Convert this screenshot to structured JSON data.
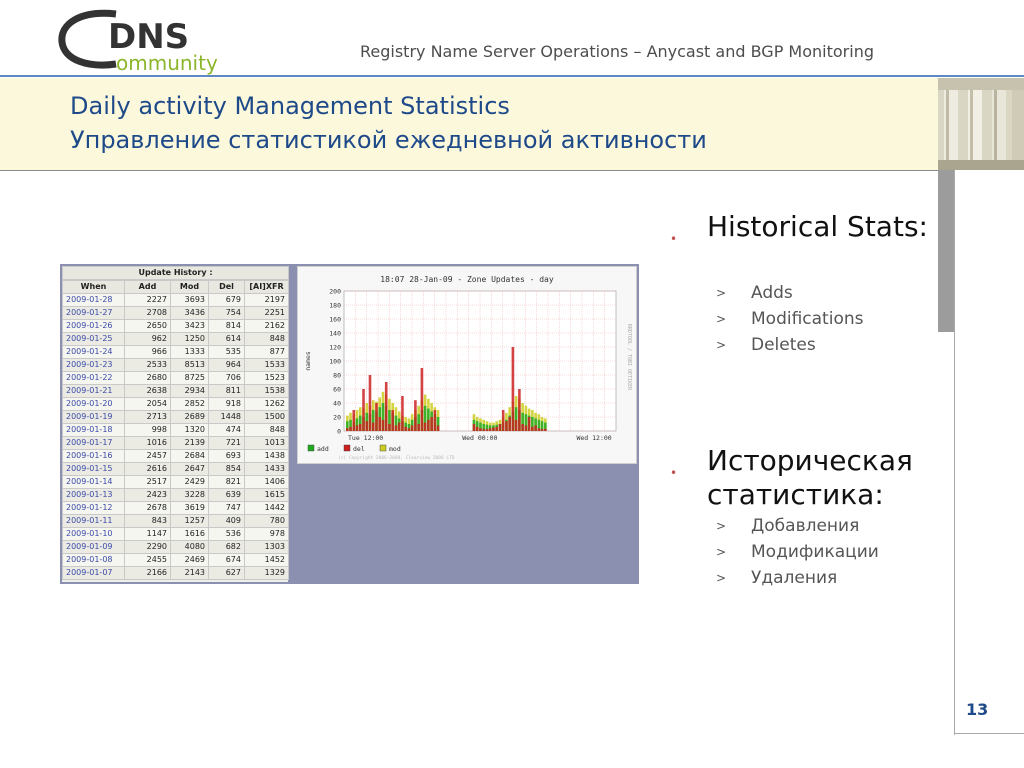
{
  "header": {
    "logo_text_top": "DNS",
    "logo_text_bottom": "ommunity",
    "subtitle": "Registry Name Server Operations – Anycast and BGP Monitoring"
  },
  "title": {
    "line1": "Daily activity Management Statistics",
    "line2": "Управление статистикой ежедневной активности"
  },
  "history": {
    "caption": "Update History :",
    "columns": [
      "When",
      "Add",
      "Mod",
      "Del",
      "[AI]XFR"
    ],
    "rows": [
      [
        "2009-01-28",
        "2227",
        "3693",
        "679",
        "2197"
      ],
      [
        "2009-01-27",
        "2708",
        "3436",
        "754",
        "2251"
      ],
      [
        "2009-01-26",
        "2650",
        "3423",
        "814",
        "2162"
      ],
      [
        "2009-01-25",
        "962",
        "1250",
        "614",
        "848"
      ],
      [
        "2009-01-24",
        "966",
        "1333",
        "535",
        "877"
      ],
      [
        "2009-01-23",
        "2533",
        "8513",
        "964",
        "1533"
      ],
      [
        "2009-01-22",
        "2680",
        "8725",
        "706",
        "1523"
      ],
      [
        "2009-01-21",
        "2638",
        "2934",
        "811",
        "1538"
      ],
      [
        "2009-01-20",
        "2054",
        "2852",
        "918",
        "1262"
      ],
      [
        "2009-01-19",
        "2713",
        "2689",
        "1448",
        "1500"
      ],
      [
        "2009-01-18",
        "998",
        "1320",
        "474",
        "848"
      ],
      [
        "2009-01-17",
        "1016",
        "2139",
        "721",
        "1013"
      ],
      [
        "2009-01-16",
        "2457",
        "2684",
        "693",
        "1438"
      ],
      [
        "2009-01-15",
        "2616",
        "2647",
        "854",
        "1433"
      ],
      [
        "2009-01-14",
        "2517",
        "2429",
        "821",
        "1406"
      ],
      [
        "2009-01-13",
        "2423",
        "3228",
        "639",
        "1615"
      ],
      [
        "2009-01-12",
        "2678",
        "3619",
        "747",
        "1442"
      ],
      [
        "2009-01-11",
        "843",
        "1257",
        "409",
        "780"
      ],
      [
        "2009-01-10",
        "1147",
        "1616",
        "536",
        "978"
      ],
      [
        "2009-01-09",
        "2290",
        "4080",
        "682",
        "1303"
      ],
      [
        "2009-01-08",
        "2455",
        "2469",
        "674",
        "1452"
      ],
      [
        "2009-01-07",
        "2166",
        "2143",
        "627",
        "1329"
      ]
    ]
  },
  "chart_data": {
    "type": "area",
    "title": "18:07 28-Jan-09 - Zone Updates - day",
    "xlabel": "",
    "ylabel": "names",
    "ylim": [
      0,
      200
    ],
    "yticks": [
      0,
      20,
      40,
      60,
      80,
      100,
      120,
      140,
      160,
      180,
      200
    ],
    "xticks": [
      "Tue 12:00",
      "Wed 00:00",
      "Wed 12:00"
    ],
    "grid": true,
    "legend_position": "bottom-left",
    "side_label": "RRDTOOL / TOBI OETIKER",
    "footer": "(c) Copyright 2006-2008, Clearview 2008 LTD",
    "series": [
      {
        "name": "add",
        "color": "#22aa22",
        "values": [
          14,
          16,
          12,
          18,
          22,
          20,
          26,
          24,
          30,
          28,
          34,
          40,
          36,
          30,
          26,
          22,
          18,
          14,
          12,
          10,
          16,
          20,
          24,
          30,
          36,
          32,
          28,
          24,
          20,
          16,
          14,
          12,
          10,
          9,
          8,
          8,
          9,
          10,
          12,
          16,
          22,
          28,
          34,
          30,
          26,
          24,
          22,
          20,
          18,
          16,
          14,
          12
        ]
      },
      {
        "name": "del",
        "color": "#cc2222",
        "values": [
          4,
          6,
          30,
          8,
          10,
          60,
          14,
          80,
          12,
          40,
          20,
          16,
          70,
          10,
          30,
          8,
          12,
          50,
          6,
          4,
          8,
          44,
          10,
          90,
          12,
          16,
          20,
          30,
          8,
          10,
          6,
          4,
          3,
          3,
          4,
          5,
          6,
          10,
          30,
          14,
          20,
          120,
          16,
          60,
          10,
          8,
          20,
          6,
          8,
          4,
          3,
          3
        ]
      },
      {
        "name": "mod",
        "color": "#cccc22",
        "values": [
          22,
          26,
          24,
          30,
          34,
          32,
          40,
          36,
          44,
          42,
          48,
          56,
          52,
          46,
          40,
          34,
          28,
          22,
          20,
          18,
          24,
          30,
          36,
          44,
          52,
          46,
          40,
          34,
          30,
          24,
          20,
          18,
          16,
          14,
          12,
          12,
          14,
          16,
          20,
          26,
          34,
          42,
          50,
          46,
          40,
          36,
          32,
          30,
          26,
          24,
          20,
          18
        ]
      }
    ]
  },
  "bullets": [
    {
      "text": "Historical Stats:",
      "items": [
        "Adds",
        "Modifications",
        "Deletes"
      ]
    },
    {
      "text": "Историческая статистика:",
      "items": [
        "Добавления",
        "Модификации",
        "Удаления"
      ]
    }
  ],
  "page_number": "13",
  "colors": {
    "title": "#1e4a8a",
    "accent_rule": "#5f87c2",
    "title_band": "#fcf8dc",
    "bullet": "#c0504d"
  }
}
